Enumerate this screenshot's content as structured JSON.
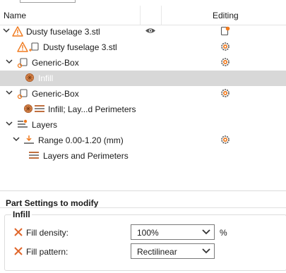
{
  "header": {
    "name_col": "Name",
    "editing_col": "Editing"
  },
  "tree": {
    "items": [
      {
        "label": "Dusty fuselage 3.stl"
      },
      {
        "label": "Dusty fuselage 3.stl"
      },
      {
        "label": "Generic-Box"
      },
      {
        "label": "Infill"
      },
      {
        "label": "Generic-Box"
      },
      {
        "label": "Infill; Lay...d Perimeters"
      },
      {
        "label": "Layers"
      },
      {
        "label": "Range 0.00-1.20 (mm)"
      },
      {
        "label": "Layers and Perimeters"
      }
    ]
  },
  "settings": {
    "title": "Part Settings to modify",
    "group": "Infill",
    "fill_density": {
      "label": "Fill density:",
      "value": "100%",
      "unit": "%"
    },
    "fill_pattern": {
      "label": "Fill pattern:",
      "value": "Rectilinear"
    }
  },
  "colors": {
    "warning": "#f07a1e",
    "selection": "#d8d8d8",
    "text": "#1a1a1a"
  }
}
